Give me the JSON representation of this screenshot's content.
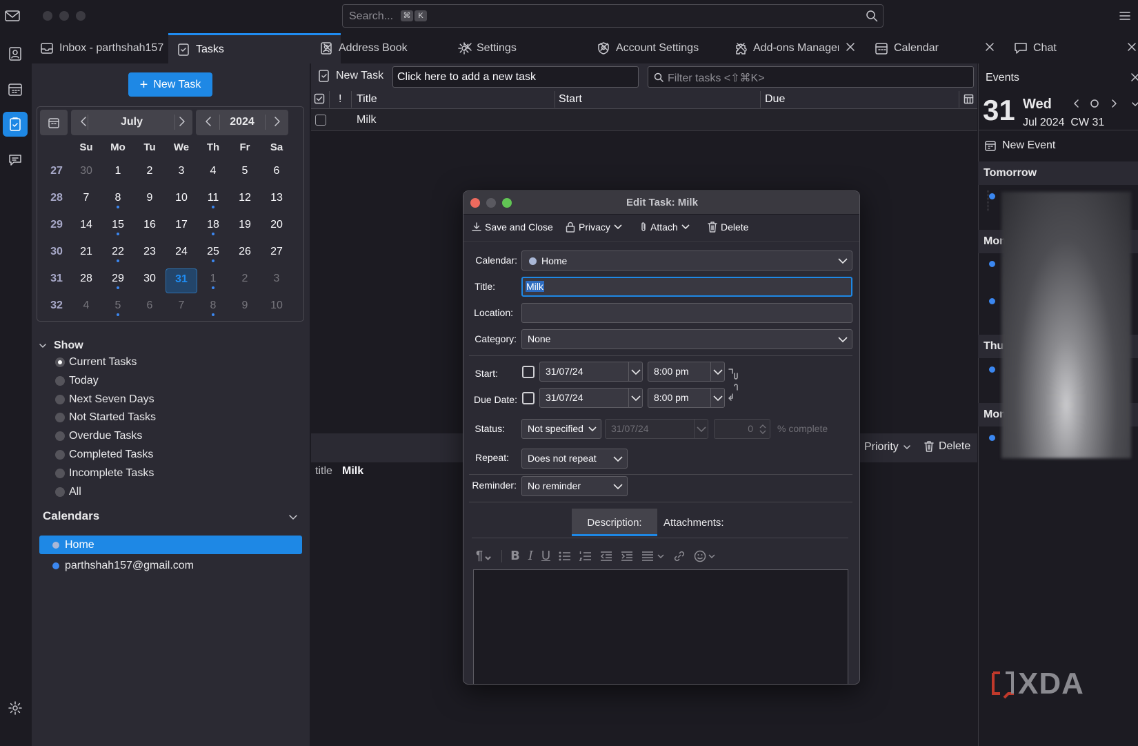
{
  "search": {
    "placeholder": "Search...",
    "key1": "⌘",
    "key2": "K"
  },
  "tabs": [
    {
      "label": "Inbox - parthshah157"
    },
    {
      "label": "Tasks"
    },
    {
      "label": "Address Book"
    },
    {
      "label": "Settings"
    },
    {
      "label": "Account Settings"
    },
    {
      "label": "Add-ons Manager"
    },
    {
      "label": "Calendar"
    },
    {
      "label": "Chat"
    }
  ],
  "sidebar": {
    "new_task": "New Task",
    "month": "July",
    "year": "2024",
    "day_headers": [
      "Su",
      "Mo",
      "Tu",
      "We",
      "Th",
      "Fr",
      "Sa"
    ],
    "weeks": [
      {
        "wk": "27",
        "days": [
          "30",
          "1",
          "2",
          "3",
          "4",
          "5",
          "6"
        ]
      },
      {
        "wk": "28",
        "days": [
          "7",
          "8",
          "9",
          "10",
          "11",
          "12",
          "13"
        ]
      },
      {
        "wk": "29",
        "days": [
          "14",
          "15",
          "16",
          "17",
          "18",
          "19",
          "20"
        ]
      },
      {
        "wk": "30",
        "days": [
          "21",
          "22",
          "23",
          "24",
          "25",
          "26",
          "27"
        ]
      },
      {
        "wk": "31",
        "days": [
          "28",
          "29",
          "30",
          "31",
          "1",
          "2",
          "3"
        ]
      },
      {
        "wk": "32",
        "days": [
          "4",
          "5",
          "6",
          "7",
          "8",
          "9",
          "10"
        ]
      }
    ],
    "show_label": "Show",
    "filters": [
      "Current Tasks",
      "Today",
      "Next Seven Days",
      "Not Started Tasks",
      "Overdue Tasks",
      "Completed Tasks",
      "Incomplete Tasks",
      "All"
    ],
    "calendars_label": "Calendars",
    "calendars": [
      {
        "name": "Home",
        "color": "#a9b7d6"
      },
      {
        "name": "parthshah157@gmail.com",
        "color": "#3b87f0"
      }
    ]
  },
  "tasks": {
    "new_task": "New Task",
    "quick_add": "Click here to add a new task",
    "filter_placeholder": "Filter tasks <⇧⌘K>",
    "priority_col": "!",
    "col_title": "Title",
    "col_start": "Start",
    "col_due": "Due",
    "rows": [
      {
        "title": "Milk"
      }
    ],
    "details": {
      "title_label": "title",
      "title_value": "Milk",
      "priority": "Priority",
      "delete": "Delete"
    }
  },
  "events": {
    "header": "Events",
    "day_num": "31",
    "weekday": "Wed",
    "sub": "Jul 2024  CW 31",
    "new_event": "New Event",
    "sections": [
      "Tomorrow",
      "Mon",
      "Thu",
      "Mon"
    ]
  },
  "dialog": {
    "title": "Edit Task: Milk",
    "toolbar": {
      "save": "Save and Close",
      "privacy": "Privacy",
      "attach": "Attach",
      "delete": "Delete"
    },
    "calendar_label": "Calendar:",
    "calendar_value": "Home",
    "title_label": "Title:",
    "title_value": "Milk",
    "location_label": "Location:",
    "location_value": "",
    "category_label": "Category:",
    "category_value": "None",
    "start_label": "Start:",
    "start_date": "31/07/24",
    "start_time": "8:00 pm",
    "due_label": "Due Date:",
    "due_date": "31/07/24",
    "due_time": "8:00 pm",
    "status_label": "Status:",
    "status_value": "Not specified",
    "status_date": "31/07/24",
    "percent_value": "0",
    "percent_label": "% complete",
    "repeat_label": "Repeat:",
    "repeat_value": "Does not repeat",
    "reminder_label": "Reminder:",
    "reminder_value": "No reminder",
    "tab_description": "Description:",
    "tab_attachments": "Attachments:"
  },
  "watermark": "XDA",
  "colors": {
    "accent": "#1e88e5",
    "bg": "#1c1b22",
    "panel": "#2b2a33",
    "dialog_red": "#ed6a5e",
    "dialog_green": "#61c554"
  }
}
